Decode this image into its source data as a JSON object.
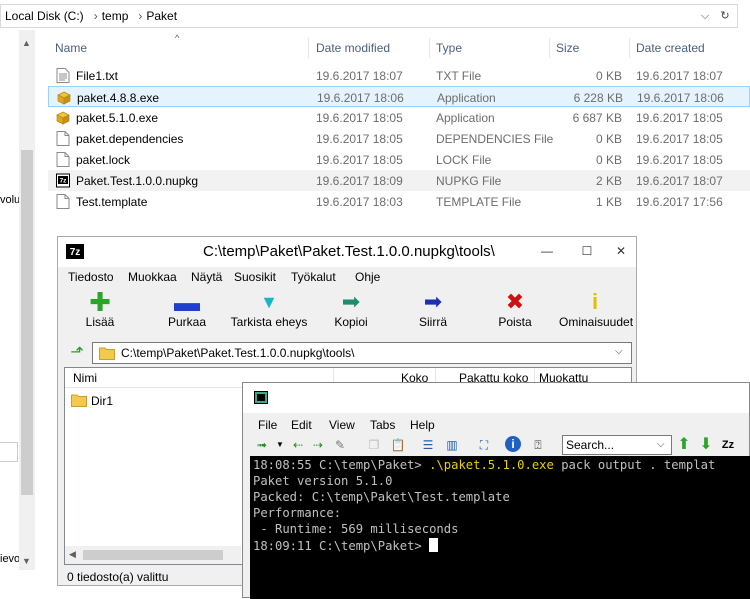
{
  "explorer": {
    "breadcrumb": [
      "Local Disk (C:)",
      "temp",
      "Paket"
    ],
    "nav_fragments": [
      "volu",
      "ievo"
    ],
    "columns": {
      "name": "Name",
      "date_modified": "Date modified",
      "type": "Type",
      "size": "Size",
      "date_created": "Date created"
    },
    "files": [
      {
        "name": "File1.txt",
        "modified": "19.6.2017 18:07",
        "type": "TXT File",
        "size": "0 KB",
        "created": "19.6.2017 18:07",
        "icon": "text-file-icon"
      },
      {
        "name": "paket.4.8.8.exe",
        "modified": "19.6.2017 18:06",
        "type": "Application",
        "size": "6 228 KB",
        "created": "19.6.2017 18:06",
        "icon": "exe-file-icon"
      },
      {
        "name": "paket.5.1.0.exe",
        "modified": "19.6.2017 18:05",
        "type": "Application",
        "size": "6 687 KB",
        "created": "19.6.2017 18:05",
        "icon": "exe-file-icon"
      },
      {
        "name": "paket.dependencies",
        "modified": "19.6.2017 18:05",
        "type": "DEPENDENCIES File",
        "size": "0 KB",
        "created": "19.6.2017 18:05",
        "icon": "blank-file-icon"
      },
      {
        "name": "paket.lock",
        "modified": "19.6.2017 18:05",
        "type": "LOCK File",
        "size": "0 KB",
        "created": "19.6.2017 18:05",
        "icon": "blank-file-icon"
      },
      {
        "name": "Paket.Test.1.0.0.nupkg",
        "modified": "19.6.2017 18:09",
        "type": "NUPKG File",
        "size": "2 KB",
        "created": "19.6.2017 18:07",
        "icon": "7zip-file-icon"
      },
      {
        "name": "Test.template",
        "modified": "19.6.2017 18:03",
        "type": "TEMPLATE File",
        "size": "1 KB",
        "created": "19.6.2017 17:56",
        "icon": "blank-file-icon"
      }
    ],
    "selected_row": 1,
    "hovered_row": 5
  },
  "sevenzip": {
    "title": "C:\\temp\\Paket\\Paket.Test.1.0.0.nupkg\\tools\\",
    "app_badge": "7z",
    "menu": [
      "Tiedosto",
      "Muokkaa",
      "Näytä",
      "Suosikit",
      "Työkalut",
      "Ohje"
    ],
    "toolbar": [
      {
        "label": "Lisää",
        "icon": "add-plus-icon",
        "color": "#2aa52a"
      },
      {
        "label": "Purkaa",
        "icon": "extract-minus-icon",
        "color": "#1e3fcf"
      },
      {
        "label": "Tarkista eheys",
        "icon": "test-check-icon",
        "color": "#19b5c8"
      },
      {
        "label": "Kopioi",
        "icon": "copy-arrow-icon",
        "color": "#1e8c6e"
      },
      {
        "label": "Siirrä",
        "icon": "move-arrow-icon",
        "color": "#1e2fb0"
      },
      {
        "label": "Poista",
        "icon": "delete-x-icon",
        "color": "#d01010"
      },
      {
        "label": "Ominaisuudet",
        "icon": "info-icon",
        "color": "#e0c000"
      }
    ],
    "path": "C:\\temp\\Paket\\Paket.Test.1.0.0.nupkg\\tools\\",
    "columns": {
      "name": "Nimi",
      "size": "Koko",
      "packed": "Pakattu koko",
      "modified": "Muokattu"
    },
    "items": [
      {
        "name": "Dir1"
      }
    ],
    "status": "0 tiedosto(a) valittu"
  },
  "terminal": {
    "menu": [
      "File",
      "Edit",
      "View",
      "Tabs",
      "Help"
    ],
    "search_placeholder": "Search...",
    "lines": [
      {
        "prompt": "18:08:55 C:\\temp\\Paket> ",
        "cmd": ".\\paket.5.1.0.exe",
        "rest": " pack output . templat"
      },
      {
        "text": "Paket version 5.1.0"
      },
      {
        "text": "Packed: C:\\temp\\Paket\\Test.template"
      },
      {
        "text": "Performance:"
      },
      {
        "text": " - Runtime: 569 milliseconds"
      },
      {
        "prompt": "18:09:11 C:\\temp\\Paket> "
      }
    ],
    "cmd_color": "#e8d000",
    "text_color": "#c0c0c0"
  }
}
